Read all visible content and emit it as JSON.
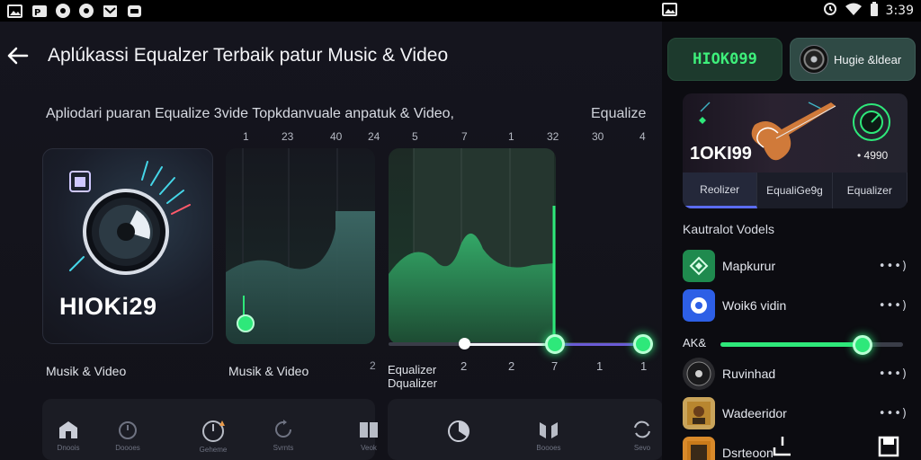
{
  "statusbar": {
    "time": "3:39",
    "icons": [
      "image-icon",
      "brand-icon",
      "dot-icon",
      "dot-icon",
      "mail-icon",
      "chat-icon",
      "image-icon",
      "alarm-icon",
      "wifi-icon",
      "battery-icon"
    ]
  },
  "header": {
    "title": "Aplúkassi Equalzer Terbaik patur Music & Video"
  },
  "subtitle": "Apliodari puaran Equalize 3vide Topkdanvuale anpatuk & Video,",
  "subtitle_right": "Equalize",
  "ticks": [
    "1",
    "23",
    "40",
    "24",
    "5",
    "7",
    "1",
    "32",
    "30",
    "4"
  ],
  "app_card": {
    "logo_text": "HIOKi29",
    "caption": "Musik & Video"
  },
  "eq_panel_1": {
    "caption": "Musik & Video",
    "marker": "2"
  },
  "eq_panel_2": {
    "caption_line1": "Equalizer",
    "caption_line2": "Dqualizer",
    "values": [
      "2",
      "2",
      "7",
      "1",
      "1"
    ]
  },
  "bottom_nav": [
    {
      "icon": "home-icon",
      "label": "Dnoois"
    },
    {
      "icon": "timer-icon",
      "label": "Doooes"
    },
    {
      "icon": "clock-icon",
      "label": "Geheme"
    },
    {
      "icon": "refresh-icon",
      "label": "Svrnts"
    },
    {
      "icon": "books-icon",
      "label": "Veok"
    },
    {
      "icon": "pie-icon",
      "label": ""
    },
    {
      "icon": "library-icon",
      "label": "Boooes"
    },
    {
      "icon": "sync-icon",
      "label": "Sevo"
    }
  ],
  "right": {
    "brand": "HIOK099",
    "account_label": "Hugie &ldear",
    "hero": {
      "title": "1OKI99",
      "count": "• 4990"
    },
    "tabs": [
      "Reolizer",
      "EqualiGe9g",
      "Equalizer"
    ],
    "section_title": "Kautralot Vodels",
    "items": [
      {
        "label": "Mapkurur",
        "more": "•••)"
      },
      {
        "label": "Woik6 vidin",
        "more": "•••)"
      }
    ],
    "volume": {
      "label": "AK&",
      "value": 0.78
    },
    "items2": [
      {
        "label": "Ruvinhad",
        "more": "•••)"
      },
      {
        "label": "Wadeeridor",
        "more": "•••)"
      },
      {
        "label": "Dsrteoon",
        "more": ""
      }
    ]
  },
  "colors": {
    "accent_green": "#2ee87a",
    "accent_purple": "#5b6cf0",
    "background": "#0d0e14"
  }
}
